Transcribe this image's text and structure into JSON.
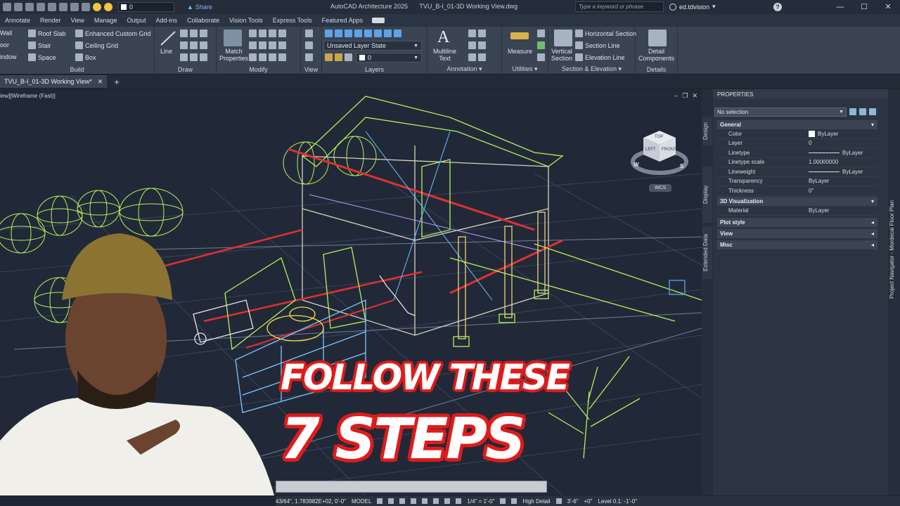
{
  "titlebar": {
    "layer_current": "0",
    "share_label": "Share",
    "app_name": "AutoCAD Architecture 2025",
    "file_name": "TVU_B-I_01-3D Working View.dwg",
    "search_placeholder": "Type a keyword or phrase",
    "username": "ed.tdvision",
    "minimize": "—",
    "maximize": "☐",
    "close": "✕",
    "help": "?"
  },
  "ribbon_tabs": [
    "Annotate",
    "Render",
    "View",
    "Manage",
    "Output",
    "Add-ins",
    "Collaborate",
    "Vision Tools",
    "Express Tools",
    "Featured Apps"
  ],
  "ribbon": {
    "build": {
      "title": "Build",
      "wall": "Wall",
      "door": "oor",
      "window": "indow",
      "roof_slab": "Roof Slab",
      "stair": "Stair",
      "space": "Space",
      "enhanced_grid": "Enhanced Custom Grid",
      "ceiling_grid": "Ceiling Grid",
      "box": "Box"
    },
    "draw": {
      "title": "Draw",
      "line": "Line"
    },
    "modify": {
      "title": "Modify",
      "match1": "Match",
      "match2": "Properties"
    },
    "view": {
      "title": "View"
    },
    "layers": {
      "title": "Layers",
      "layer_state": "Unsaved Layer State",
      "layer_value": "0"
    },
    "annotation": {
      "title": "Annotation",
      "multiline1": "Multiline",
      "multiline2": "Text"
    },
    "utilities": {
      "title": "Utilities",
      "measure": "Measure"
    },
    "section": {
      "title": "Section & Elevation",
      "vertical1": "Vertical",
      "vertical2": "Section",
      "horizontal": "Horizontal Section",
      "section_line": "Section Line",
      "elevation_line": "Elevation Line"
    },
    "details": {
      "title": "Details",
      "detail1": "Detail",
      "detail2": "Components"
    }
  },
  "doc_tab": {
    "name": "TVU_B-I_01-3D Working View*",
    "close": "✕",
    "new": "+"
  },
  "viewport": {
    "label": "iew][Wireframe (Fast)]",
    "min": "–",
    "restore": "❐",
    "close": "✕",
    "viewcube_top": "TOP",
    "viewcube_left": "LEFT",
    "viewcube_front": "FRONT",
    "compass_w": "W",
    "compass_s": "S",
    "wcs": "WCS"
  },
  "overlay": {
    "line1": "FOLLOW THESE",
    "line2": "7 STEPS"
  },
  "statusbar": {
    "coords": "43/64\", 1.783982E+02, 0'-0\"",
    "model": "MODEL",
    "scale": "1/4\" = 1'-0\"",
    "detail": "High Detail",
    "dim": "3'-6\"",
    "elev": "+0\"",
    "level": "Level 0.1: -1'-0\""
  },
  "properties": {
    "title": "PROPERTIES",
    "selection": "No selection",
    "side_tabs": [
      "Design",
      "Display",
      "Extended Data"
    ],
    "general_title": "General",
    "general_rows": [
      {
        "k": "Color",
        "v": "ByLayer"
      },
      {
        "k": "Layer",
        "v": "0"
      },
      {
        "k": "Linetype",
        "v": "ByLayer"
      },
      {
        "k": "Linetype scale",
        "v": "1.00000000"
      },
      {
        "k": "Lineweight",
        "v": "ByLayer"
      },
      {
        "k": "Transparency",
        "v": "ByLayer"
      },
      {
        "k": "Thickness",
        "v": "0\""
      }
    ],
    "viz_title": "3D Visualization",
    "viz_rows": [
      {
        "k": "Material",
        "v": "ByLayer"
      }
    ],
    "plot_style": "Plot style",
    "view": "View",
    "misc": "Misc",
    "navigator": "Project Navigator - Mordecai Floor Plan"
  },
  "colors": {
    "wire_green": "#b6f05a",
    "wire_yellow": "#f2d27a",
    "wire_red": "#e03030",
    "overlay_red": "#e01b1b",
    "accent_blue": "#7ab8ff"
  }
}
